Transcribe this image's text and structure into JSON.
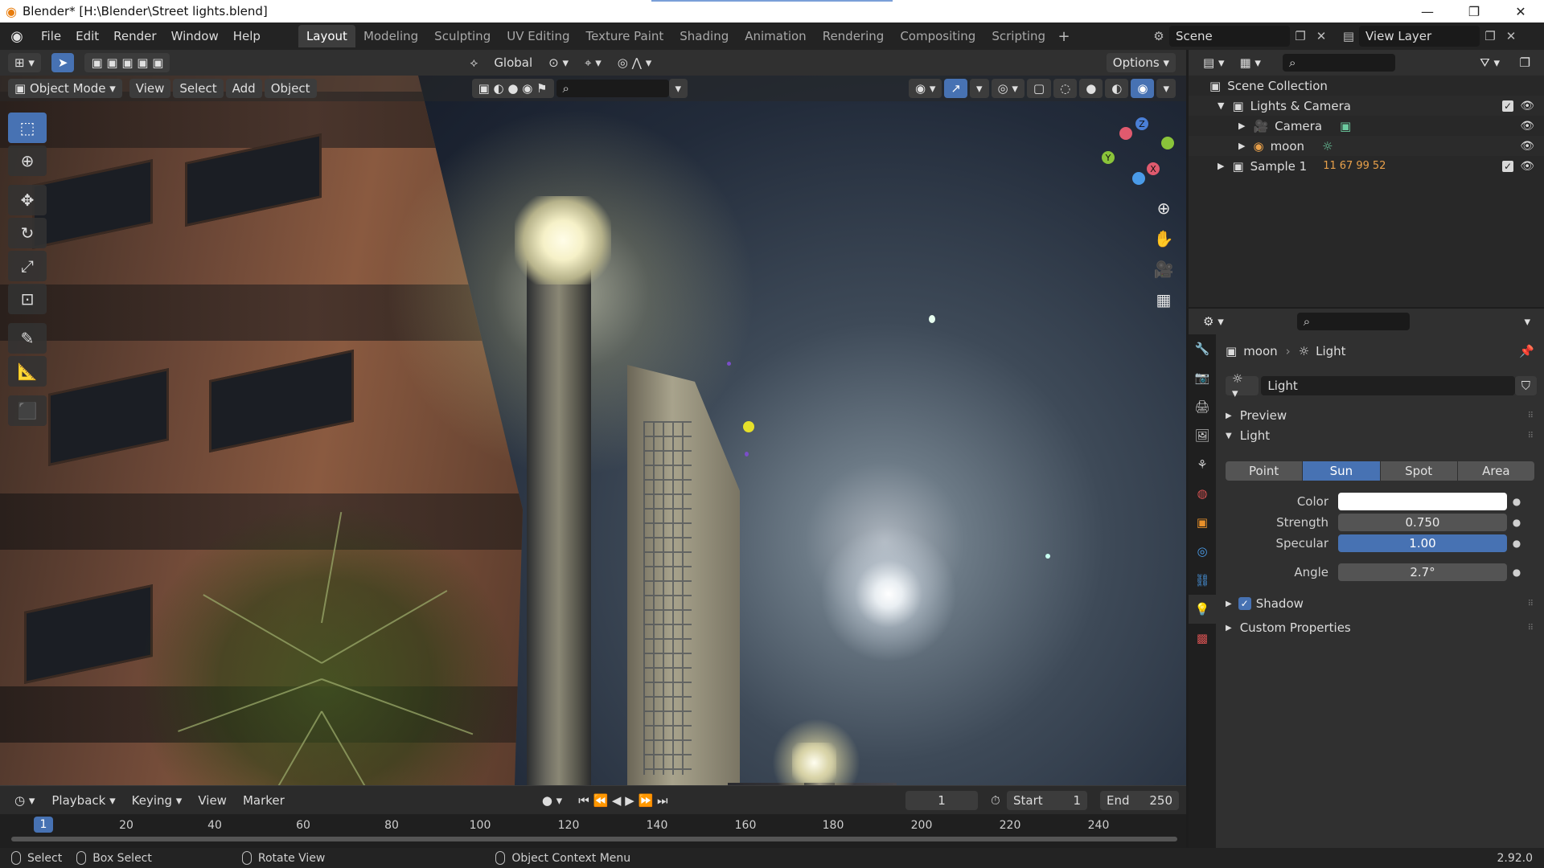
{
  "window": {
    "title": "Blender* [H:\\Blender\\Street lights.blend]",
    "minimize": "—",
    "maximize": "❐",
    "close": "✕"
  },
  "menubar": {
    "items": [
      "File",
      "Edit",
      "Render",
      "Window",
      "Help"
    ],
    "workspaces": [
      "Layout",
      "Modeling",
      "Sculpting",
      "UV Editing",
      "Texture Paint",
      "Shading",
      "Animation",
      "Rendering",
      "Compositing",
      "Scripting"
    ],
    "active_workspace": "Layout",
    "scene": "Scene",
    "view_layer": "View Layer"
  },
  "viewport": {
    "transform_orientation": "Global",
    "options_label": "Options",
    "mode": "Object Mode",
    "menus": [
      "View",
      "Select",
      "Add",
      "Object"
    ],
    "gizmo": {
      "x": "X",
      "y": "Y",
      "z": "Z"
    }
  },
  "timeline": {
    "menus": [
      "Playback",
      "Keying",
      "View",
      "Marker"
    ],
    "current_frame": "1",
    "start_label": "Start",
    "start": "1",
    "end_label": "End",
    "end": "250",
    "cursor_frame": "1",
    "ticks": [
      "20",
      "40",
      "60",
      "80",
      "100",
      "120",
      "140",
      "160",
      "180",
      "200",
      "220",
      "240"
    ]
  },
  "statusbar": {
    "select": "Select",
    "box_select": "Box Select",
    "rotate_view": "Rotate View",
    "context_menu": "Object Context Menu",
    "version": "2.92.0"
  },
  "outliner": {
    "root": "Scene Collection",
    "rows": [
      {
        "label": "Lights & Camera",
        "indent": 1
      },
      {
        "label": "Camera",
        "indent": 2
      },
      {
        "label": "moon",
        "indent": 2
      },
      {
        "label": "Sample 1",
        "indent": 1
      }
    ],
    "sample_counts": [
      "11",
      "67",
      "99",
      "52"
    ]
  },
  "properties": {
    "breadcrumb_object": "moon",
    "breadcrumb_data": "Light",
    "datablock": "Light",
    "sections": {
      "preview": "Preview",
      "light": "Light",
      "shadow": "Shadow",
      "custom": "Custom Properties"
    },
    "light_types": [
      "Point",
      "Sun",
      "Spot",
      "Area"
    ],
    "selected_type": "Sun",
    "color_label": "Color",
    "color_value": "#ffffff",
    "strength_label": "Strength",
    "strength": "0.750",
    "specular_label": "Specular",
    "specular": "1.00",
    "angle_label": "Angle",
    "angle": "2.7°"
  },
  "colors": {
    "accent": "#4772b3",
    "panel": "#303030",
    "header": "#232323"
  }
}
